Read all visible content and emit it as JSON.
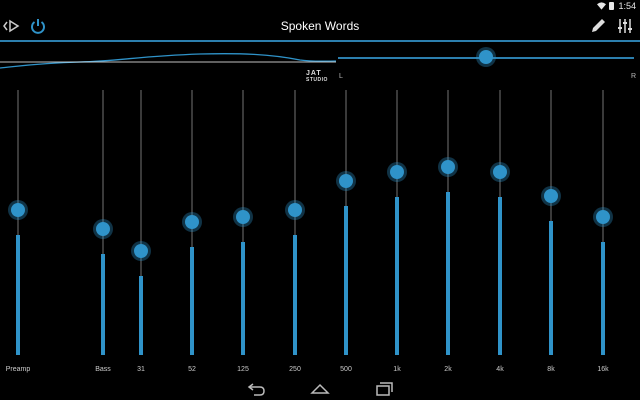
{
  "status": {
    "time": "1:54"
  },
  "header": {
    "title": "Spoken Words"
  },
  "balance": {
    "left_label": "L",
    "right_label": "R",
    "value": 0.5
  },
  "logo": {
    "text": "JAT",
    "subtext": "STUDIO"
  },
  "preamp": {
    "label": "Preamp",
    "level": 0.5
  },
  "bass": {
    "label": "Bass",
    "level": 0.42
  },
  "bands": [
    {
      "label": "31",
      "level": 0.33
    },
    {
      "label": "52",
      "level": 0.45
    },
    {
      "label": "125",
      "level": 0.47
    },
    {
      "label": "250",
      "level": 0.5
    },
    {
      "label": "500",
      "level": 0.62
    },
    {
      "label": "1k",
      "level": 0.66
    },
    {
      "label": "2k",
      "level": 0.68
    },
    {
      "label": "4k",
      "level": 0.66
    },
    {
      "label": "8k",
      "level": 0.56
    },
    {
      "label": "16k",
      "level": 0.47
    }
  ],
  "colors": {
    "accent": "#2f93c9",
    "track": "#3a3a3a",
    "background": "#000000"
  }
}
